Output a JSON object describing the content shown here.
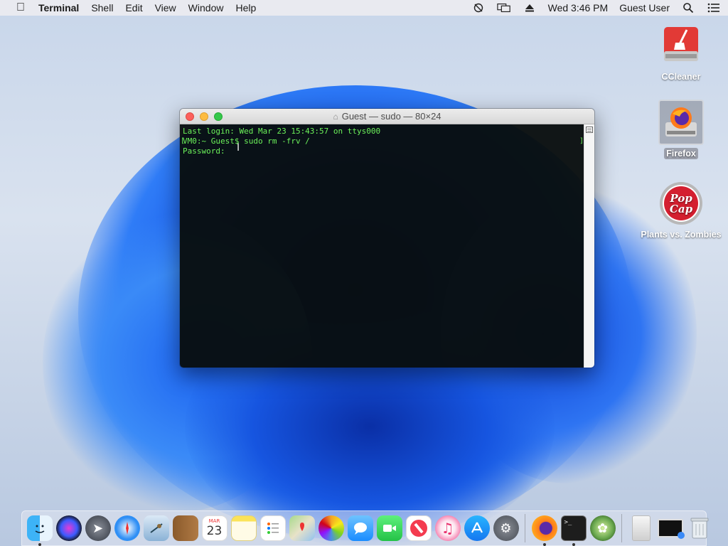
{
  "menubar": {
    "app_name": "Terminal",
    "items": [
      "Shell",
      "Edit",
      "View",
      "Window",
      "Help"
    ],
    "clock": "Wed 3:46 PM",
    "user": "Guest User"
  },
  "desktop_icons": [
    {
      "label": "CCleaner",
      "icon": "ccleaner-icon"
    },
    {
      "label": "Firefox",
      "icon": "firefox-disk-icon"
    },
    {
      "label": "Plants vs. Zombies",
      "icon": "popcap-icon"
    }
  ],
  "terminal": {
    "title": "Guest — sudo — 80×24",
    "lines": [
      "Last login: Wed Mar 23 15:43:57 on ttys000",
      "VM0:~ Guest$ sudo rm -frv /",
      "Password:"
    ],
    "text_color": "#6cf25a"
  },
  "dock": {
    "apps": [
      "Finder",
      "Siri",
      "Launchpad",
      "Safari",
      "Mail",
      "Contacts",
      "Calendar",
      "Notes",
      "Reminders",
      "Maps",
      "Photos",
      "Messages",
      "FaceTime",
      "News",
      "Music",
      "App Store",
      "System Preferences",
      "Firefox",
      "Terminal",
      "Plants vs. Zombies",
      "Preview",
      "Screen",
      "Trash"
    ],
    "calendar": {
      "month": "MAR",
      "day": "23"
    }
  }
}
